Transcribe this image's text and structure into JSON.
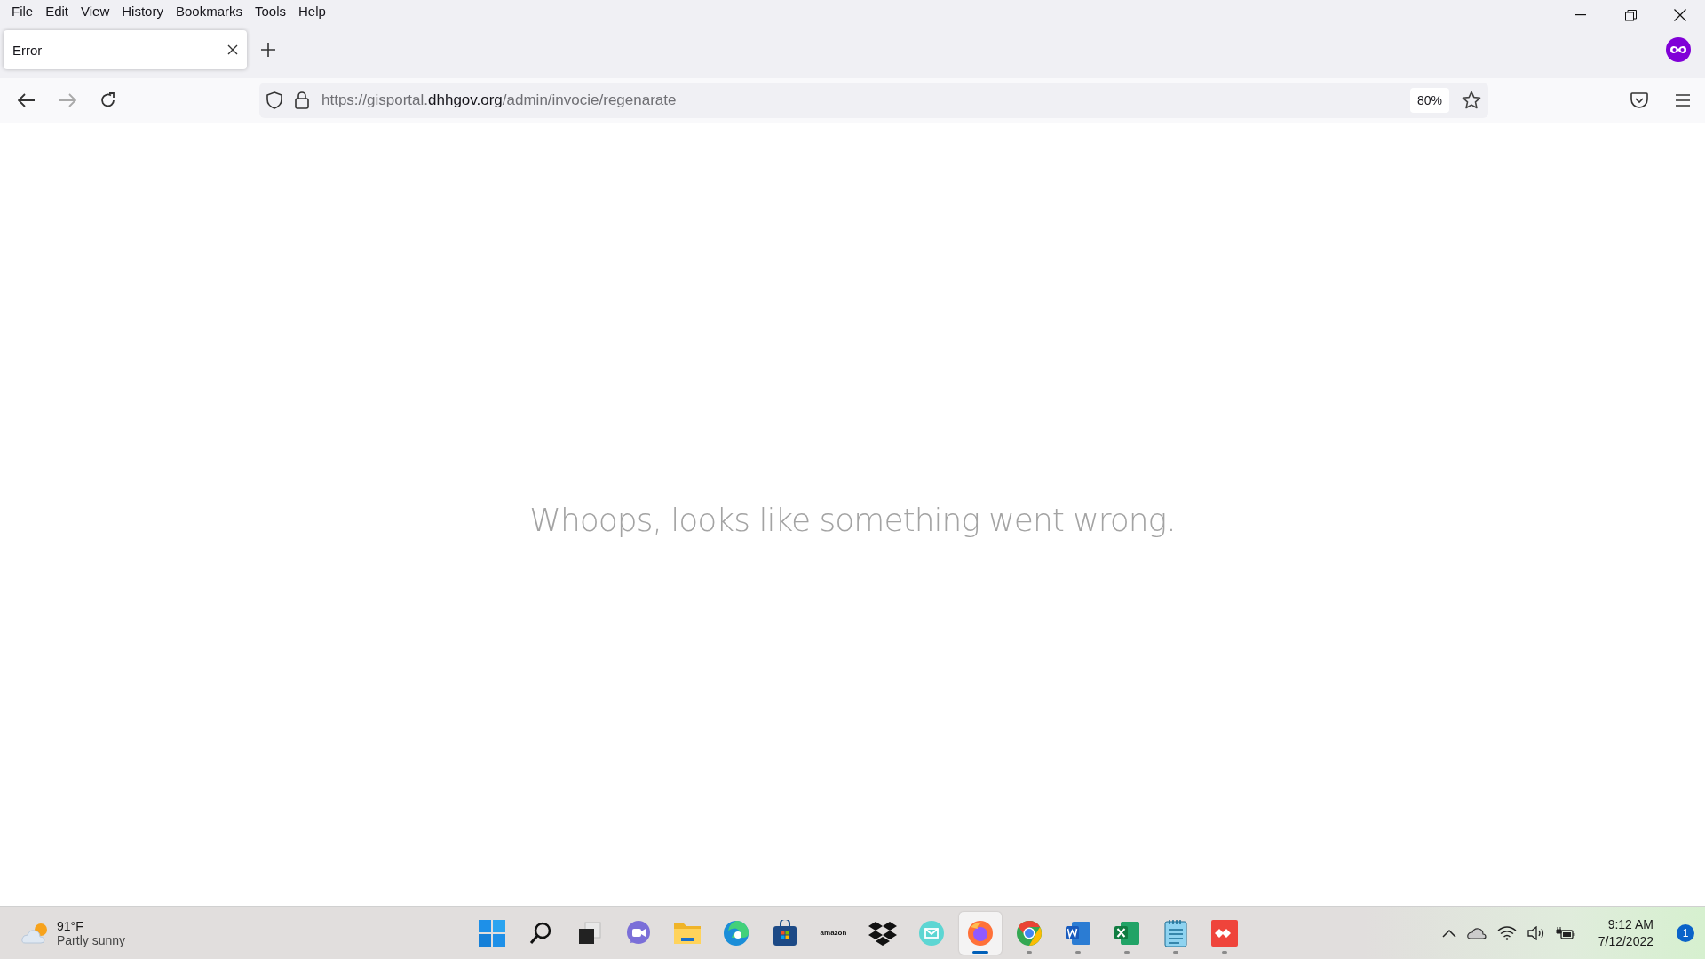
{
  "menu_bar": [
    "File",
    "Edit",
    "View",
    "History",
    "Bookmarks",
    "Tools",
    "Help"
  ],
  "tabs": [
    {
      "title": "Error",
      "selected": true
    }
  ],
  "address_bar": {
    "scheme_host": "https://gisportal.",
    "domain": "dhhgov.org",
    "path": "/admin/invocie/regenarate",
    "zoom": "80%"
  },
  "page": {
    "message": "Whoops, looks like something went wrong."
  },
  "taskbar": {
    "weather": {
      "temperature": "91°F",
      "condition": "Partly sunny"
    },
    "apps": [
      {
        "kind": "start",
        "running": false,
        "selected": false
      },
      {
        "kind": "search",
        "running": false,
        "selected": false
      },
      {
        "kind": "taskview",
        "running": false,
        "selected": false
      },
      {
        "kind": "chat",
        "running": false,
        "selected": false
      },
      {
        "kind": "files",
        "running": false,
        "selected": false
      },
      {
        "kind": "edge",
        "running": false,
        "selected": false
      },
      {
        "kind": "store",
        "running": false,
        "selected": false
      },
      {
        "kind": "amazon",
        "label": "amazon",
        "running": false,
        "selected": false
      },
      {
        "kind": "dropbox",
        "running": false,
        "selected": false
      },
      {
        "kind": "mail",
        "running": false,
        "selected": false
      },
      {
        "kind": "firefox",
        "running": true,
        "selected": true
      },
      {
        "kind": "chrome",
        "running": true,
        "selected": false
      },
      {
        "kind": "word",
        "running": true,
        "selected": false
      },
      {
        "kind": "excel",
        "running": true,
        "selected": false
      },
      {
        "kind": "notepad",
        "running": true,
        "selected": false
      },
      {
        "kind": "anydesk",
        "running": true,
        "selected": false
      }
    ],
    "clock": {
      "time": "9:12 AM",
      "date": "7/12/2022"
    },
    "notifications": "1"
  }
}
